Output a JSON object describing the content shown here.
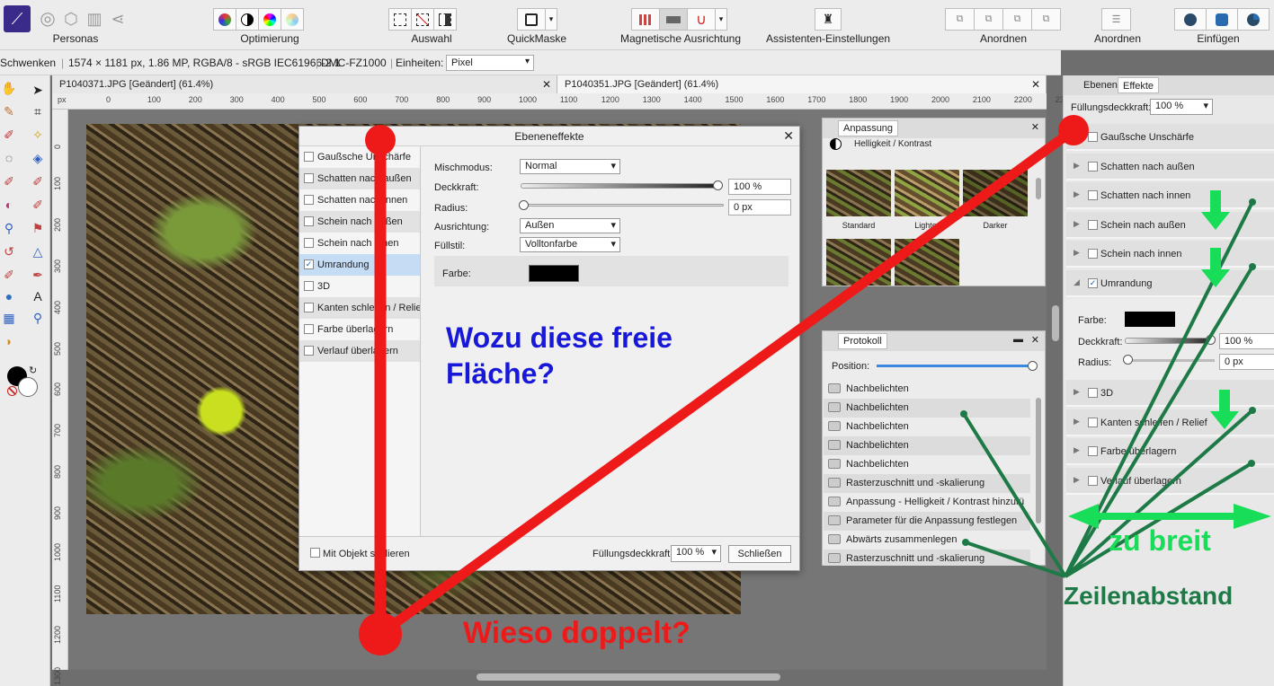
{
  "toolbar": {
    "personas_label": "Personas",
    "optimierung_label": "Optimierung",
    "auswahl_label": "Auswahl",
    "quickmaske_label": "QuickMaske",
    "magnet_label": "Magnetische Ausrichtung",
    "assistent_label": "Assistenten-Einstellungen",
    "anordnen1_label": "Anordnen",
    "anordnen2_label": "Anordnen",
    "einfuegen_label": "Einfügen"
  },
  "context": {
    "tool": "Schwenken",
    "info": "1574 × 1181 px, 1.86 MP, RGBA/8 - sRGB IEC61966-2.1",
    "camera": "DMC-FZ1000",
    "units_label": "Einheiten:",
    "units_value": "Pixel"
  },
  "tabs": [
    {
      "title": "P1040371.JPG [Geändert] (61.4%)"
    },
    {
      "title": "P1040351.JPG [Geändert] (61.4%)"
    }
  ],
  "ruler": {
    "unit": "px",
    "h_ticks": [
      "0",
      "100",
      "200",
      "300",
      "400",
      "500",
      "600",
      "700",
      "800",
      "900",
      "1000",
      "1100",
      "1200",
      "1300",
      "1400",
      "1500",
      "1600",
      "1700",
      "1800",
      "1900",
      "2000",
      "2100",
      "2200",
      "230"
    ],
    "v_ticks": [
      "0",
      "100",
      "200",
      "300",
      "400",
      "500",
      "600",
      "700",
      "800",
      "900",
      "1000",
      "1100",
      "1200",
      "1300"
    ]
  },
  "dialog": {
    "title": "Ebeneneffekte",
    "effects": [
      {
        "label": "Gaußsche Unschärfe",
        "checked": false
      },
      {
        "label": "Schatten nach außen",
        "checked": false
      },
      {
        "label": "Schatten nach innen",
        "checked": false
      },
      {
        "label": "Schein nach außen",
        "checked": false
      },
      {
        "label": "Schein nach innen",
        "checked": false
      },
      {
        "label": "Umrandung",
        "checked": true
      },
      {
        "label": "3D",
        "checked": false
      },
      {
        "label": "Kanten schleifen / Relief",
        "checked": false
      },
      {
        "label": "Farbe überlagern",
        "checked": false
      },
      {
        "label": "Verlauf überlagern",
        "checked": false
      }
    ],
    "mischmodus_label": "Mischmodus:",
    "mischmodus_value": "Normal",
    "deckkraft_label": "Deckkraft:",
    "deckkraft_value": "100 %",
    "radius_label": "Radius:",
    "radius_value": "0 px",
    "ausrichtung_label": "Ausrichtung:",
    "ausrichtung_value": "Außen",
    "fuellstil_label": "Füllstil:",
    "fuellstil_value": "Volltonfarbe",
    "farbe_label": "Farbe:",
    "farbe_color": "#000000",
    "mit_objekt_label": "Mit Objekt skalieren",
    "fuell_label": "Füllungsdeckkraft:",
    "fuell_value": "100 %",
    "close_label": "Schließen"
  },
  "adjust_panel": {
    "tab": "Anpassung",
    "heading": "Helligkeit / Kontrast",
    "presets": [
      "Standard",
      "Lighter",
      "Darker"
    ]
  },
  "history_panel": {
    "tab": "Protokoll",
    "position_label": "Position:",
    "items": [
      "Nachbelichten",
      "Nachbelichten",
      "Nachbelichten",
      "Nachbelichten",
      "Nachbelichten",
      "Rasterzuschnitt und -skalierung",
      "Anpassung - Helligkeit / Kontrast hinzufü",
      "Parameter für die Anpassung festlegen",
      "Abwärts zusammenlegen",
      "Rasterzuschnitt und -skalierung"
    ]
  },
  "right_panel": {
    "tab_ebenen": "Ebenen",
    "tab_effekte": "Effekte",
    "fuell_label": "Füllungsdeckkraft:",
    "fuell_value": "100 %",
    "effects": [
      {
        "label": "Gaußsche Unschärfe",
        "checked": false
      },
      {
        "label": "Schatten nach außen",
        "checked": false
      },
      {
        "label": "Schatten nach innen",
        "checked": false
      },
      {
        "label": "Schein nach außen",
        "checked": false
      },
      {
        "label": "Schein nach innen",
        "checked": false
      },
      {
        "label": "Umrandung",
        "checked": true
      },
      {
        "label": "3D",
        "checked": false
      },
      {
        "label": "Kanten schleifen / Relief",
        "checked": false
      },
      {
        "label": "Farbe überlagern",
        "checked": false
      },
      {
        "label": "Verlauf überlagern",
        "checked": false
      }
    ],
    "farbe_label": "Farbe:",
    "deckkraft_label": "Deckkraft:",
    "deckkraft_value": "100 %",
    "radius_label": "Radius:",
    "radius_value": "0 px"
  },
  "annotations": {
    "blue_line1": "Wozu diese freie",
    "blue_line2": "Fläche?",
    "red": "Wieso doppelt?",
    "green": "zu breit",
    "dark_green": "Zeilenabstand",
    "color_red": "#ee1a1a",
    "color_green": "#18dd58",
    "color_dark_green": "#1d7a46"
  }
}
